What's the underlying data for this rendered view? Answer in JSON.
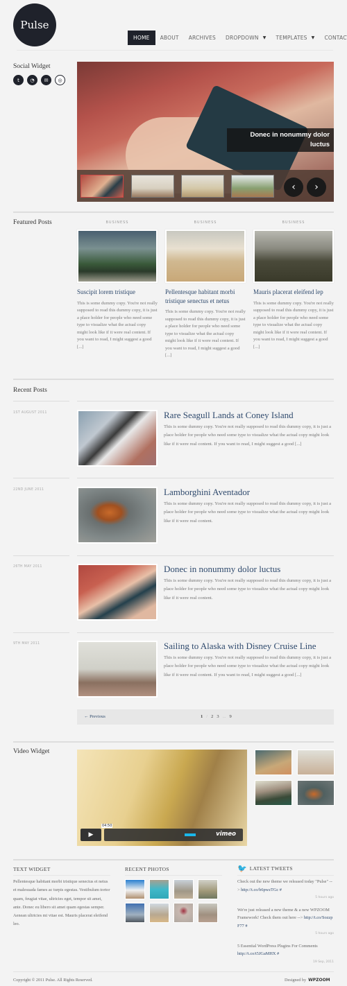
{
  "site": {
    "logo": "Pulse"
  },
  "nav": {
    "items": [
      {
        "label": "HOME",
        "active": true
      },
      {
        "label": "ABOUT"
      },
      {
        "label": "ARCHIVES"
      },
      {
        "label": "DROPDOWN",
        "dropdown": true
      },
      {
        "label": "TEMPLATES",
        "dropdown": true
      },
      {
        "label": "CONTACT"
      }
    ]
  },
  "social_widget": {
    "title": "Social Widget",
    "icons": [
      "twitter-icon",
      "rss-icon",
      "email-icon",
      "dribbble-icon"
    ]
  },
  "slider": {
    "caption": "Donec in nonummy dolor luctus",
    "prev": "‹",
    "next": "›"
  },
  "featured": {
    "title": "Featured Posts",
    "posts": [
      {
        "category": "BUSINESS",
        "title": "Suscipit lorem tristique",
        "excerpt": "This is some dummy copy. You're not really supposed to read this dummy copy, it is just a place holder for people who need some type to visualize what the actual copy might look like if it were real content. If you want to read, I might suggest a good [...]"
      },
      {
        "category": "BUSINESS",
        "title": "Pellentesque habitant morbi tristique senectus et netus",
        "excerpt": "This is some dummy copy. You're not really supposed to read this dummy copy, it is just a place holder for people who need some type to visualize what the actual copy might look like if it were real content. If you want to read, I might suggest a good [...]"
      },
      {
        "category": "BUSINESS",
        "title": "Mauris placerat eleifend lep",
        "excerpt": "This is some dummy copy. You're not really supposed to read this dummy copy, it is just a place holder for people who need some type to visualize what the actual copy might look like if it were real content. If you want to read, I might suggest a good [...]"
      }
    ]
  },
  "recent": {
    "title": "Recent Posts",
    "posts": [
      {
        "date": "1ST AUGUST 2011",
        "title": "Rare Seagull Lands at Coney Island",
        "excerpt": "This is some dummy copy. You're not really supposed to read this dummy copy, it is just a place holder for people who need some type to visualize what the actual copy might look like if it were real content. If you want to read, I might suggest a good [...]"
      },
      {
        "date": "22ND JUNE 2011",
        "title": "Lamborghini Aventador",
        "excerpt": "This is some dummy copy. You're not really supposed to read this dummy copy, it is just a place holder for people who need some type to visualize what the actual copy might look like if it were real content."
      },
      {
        "date": "26TH MAY 2011",
        "title": "Donec in nonummy dolor luctus",
        "excerpt": "This is some dummy copy. You're not really supposed to read this dummy copy, it is just a place holder for people who need some type to visualize what the actual copy might look like if it were real content."
      },
      {
        "date": "9TH MAY 2011",
        "title": "Sailing to Alaska with Disney Cruise Line",
        "excerpt": "This is some dummy copy. You're not really supposed to read this dummy copy, it is just a place holder for people who need some type to visualize what the actual copy might look like if it were real content. If you want to read, I might suggest a good [...]"
      }
    ]
  },
  "pagination": {
    "prev": "← Previous",
    "pages": [
      "1",
      "2",
      "3",
      "...",
      "9"
    ],
    "current": "1"
  },
  "video_widget": {
    "title": "Video Widget",
    "time": "04:50",
    "provider": "vimeo",
    "play": "▶"
  },
  "text_widget": {
    "title": "TEXT WIDGET",
    "text": "Pellentesque habitant morbi tristique senectus et netus et malesuada fames ac turpis egestas. Vestibulum tortor quam, feugiat vitae, ultricies eget, tempor sit amet, ante. Donec eu libero sit amet quam egestas semper. Aenean ultricies mi vitae est. Mauris placerat eleifend leo."
  },
  "recent_photos": {
    "title": "RECENT PHOTOS"
  },
  "tweets": {
    "title": "LATEST TWEETS",
    "items": [
      {
        "text": "Check out the new theme we released today \"Pulse\" -->",
        "link": "http://t.co/b6pwzTGc",
        "hash": "#",
        "ago": "5 hours ago"
      },
      {
        "text": "We're just released a new theme & a new WPZOOM Framework! Check them out here -->",
        "link": "http://t.co/Sozzp F77",
        "hash": "#",
        "ago": "5 hours ago"
      },
      {
        "text": "5 Essential WordPress Plugins For Comments",
        "link": "http://t.co/t5JGaMHX",
        "hash": "#",
        "ago": "19 Sep, 2011"
      }
    ]
  },
  "footer": {
    "copyright": "Copyright © 2011 Pulse. All Rights Reserved.",
    "designed_by": "Designed by",
    "designer": "WPZOOM"
  }
}
